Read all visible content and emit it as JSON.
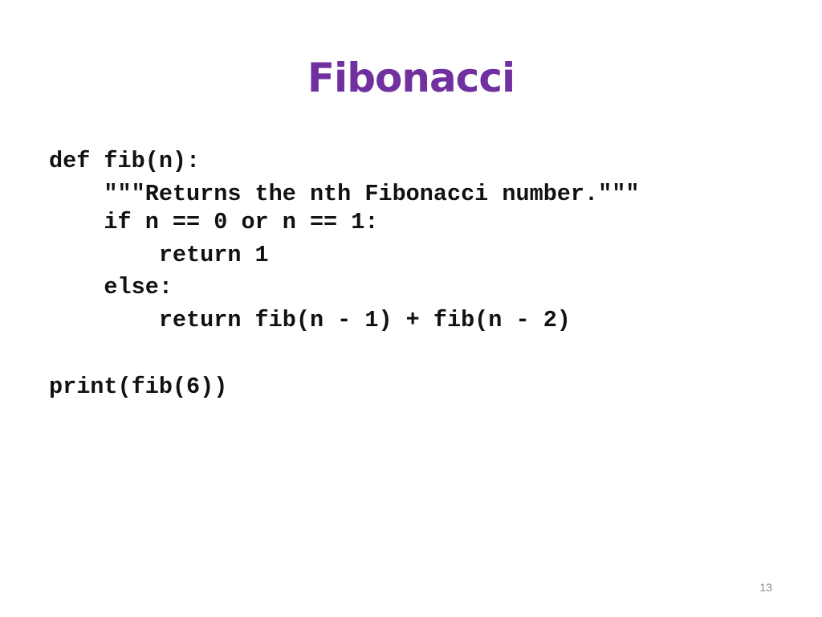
{
  "slide": {
    "title": "Fibonacci",
    "title_color": "#7030a0",
    "code_lines": [
      "def fib(n):",
      "    \"\"\"Returns the nth Fibonacci number.\"\"\"",
      "    if n == 0 or n == 1:",
      "        return 1",
      "    else:",
      "        return fib(n - 1) + fib(n - 2)",
      "",
      "print(fib(6))"
    ],
    "page_number": "13"
  }
}
